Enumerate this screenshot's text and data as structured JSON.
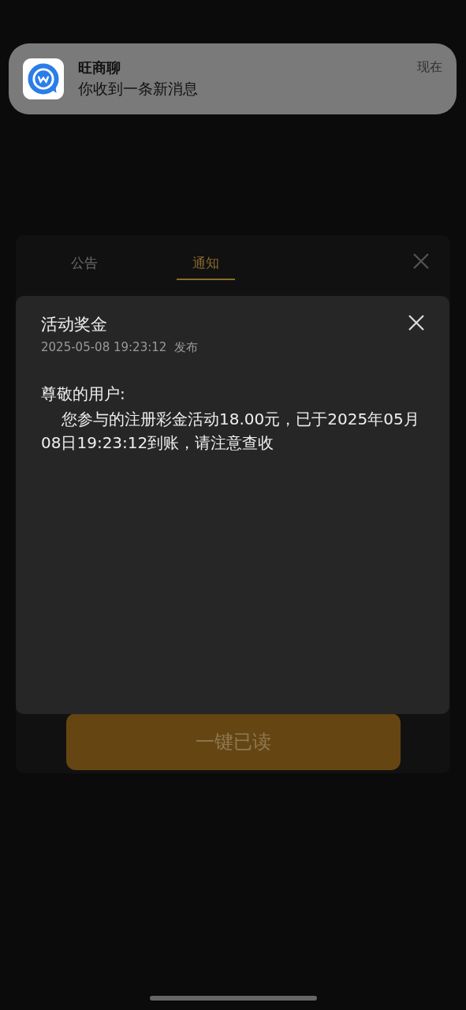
{
  "notification": {
    "app": "旺商聊",
    "message": "你收到一条新消息",
    "time": "现在"
  },
  "tabs": [
    {
      "label": "公告",
      "selected": false
    },
    {
      "label": "通知",
      "selected": true
    }
  ],
  "dialog": {
    "title": "活动奖金",
    "date": "2025-05-08 19:23:12",
    "status": "发布",
    "greeting": "尊敬的用户:",
    "body": "您参与的注册彩金活动18.00元，已于2025年05月08日19:23:12到账，请注意查收"
  },
  "button": {
    "label": "一键已读"
  }
}
